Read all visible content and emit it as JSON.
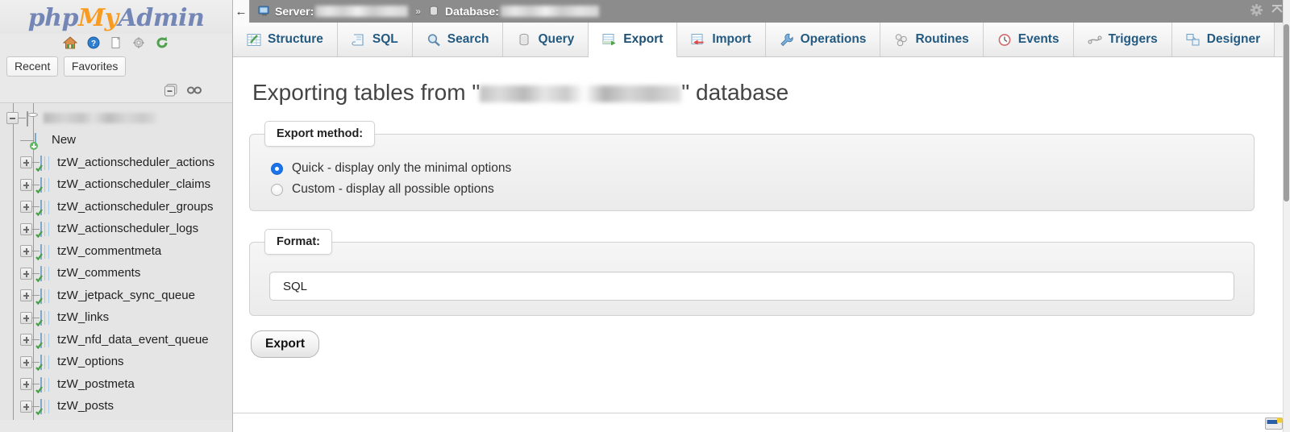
{
  "sidebar": {
    "logo": {
      "part1": "php",
      "part2": "My",
      "part3": "Admin"
    },
    "icons": [
      {
        "name": "home-icon",
        "title": "Home"
      },
      {
        "name": "help-icon",
        "title": "Documentation"
      },
      {
        "name": "docs-icon",
        "title": "Docs"
      },
      {
        "name": "settings-icon",
        "title": "Settings"
      },
      {
        "name": "reload-icon",
        "title": "Reload navigation"
      }
    ],
    "quick_buttons": [
      {
        "label": "Recent"
      },
      {
        "label": "Favorites"
      }
    ],
    "tree_tools": [
      {
        "name": "collapse-all-icon"
      },
      {
        "name": "link-with-main-panel-icon"
      }
    ],
    "database_node": {
      "label": "",
      "redacted": true
    },
    "new_item": {
      "label": "New"
    },
    "tables": [
      {
        "label": "tzW_actionscheduler_actions"
      },
      {
        "label": "tzW_actionscheduler_claims"
      },
      {
        "label": "tzW_actionscheduler_groups"
      },
      {
        "label": "tzW_actionscheduler_logs"
      },
      {
        "label": "tzW_commentmeta"
      },
      {
        "label": "tzW_comments"
      },
      {
        "label": "tzW_jetpack_sync_queue"
      },
      {
        "label": "tzW_links"
      },
      {
        "label": "tzW_nfd_data_event_queue"
      },
      {
        "label": "tzW_options"
      },
      {
        "label": "tzW_postmeta"
      },
      {
        "label": "tzW_posts"
      }
    ]
  },
  "topbar": {
    "back_label": "←",
    "server_label": "Server:",
    "server_value": "",
    "separator": "»",
    "database_label": "Database:",
    "database_value": "",
    "gear_title": "Settings",
    "collapse_title": "Collapse"
  },
  "tabs": [
    {
      "label": "Structure",
      "icon": "structure-icon",
      "active": false
    },
    {
      "label": "SQL",
      "icon": "sql-icon",
      "active": false
    },
    {
      "label": "Search",
      "icon": "search-icon",
      "active": false
    },
    {
      "label": "Query",
      "icon": "query-icon",
      "active": false
    },
    {
      "label": "Export",
      "icon": "export-icon",
      "active": true
    },
    {
      "label": "Import",
      "icon": "import-icon",
      "active": false
    },
    {
      "label": "Operations",
      "icon": "wrench-icon",
      "active": false
    },
    {
      "label": "Routines",
      "icon": "routines-icon",
      "active": false
    },
    {
      "label": "Events",
      "icon": "clock-icon",
      "active": false
    },
    {
      "label": "Triggers",
      "icon": "triggers-icon",
      "active": false
    },
    {
      "label": "Designer",
      "icon": "designer-icon",
      "active": false
    }
  ],
  "main": {
    "title_prefix": "Exporting tables from \"",
    "title_db": "",
    "title_suffix": "\" database",
    "export_method": {
      "legend": "Export method:",
      "options": [
        {
          "label": "Quick - display only the minimal options",
          "selected": true
        },
        {
          "label": "Custom - display all possible options",
          "selected": false
        }
      ]
    },
    "format": {
      "legend": "Format:",
      "selected_value": "SQL"
    },
    "export_button": "Export"
  },
  "colors": {
    "accent_blue": "#1a73e8",
    "tab_text": "#235a81",
    "topbar_bg": "#8c8c8c",
    "logo_orange": "#f89b20",
    "logo_blue": "#7486b5"
  }
}
